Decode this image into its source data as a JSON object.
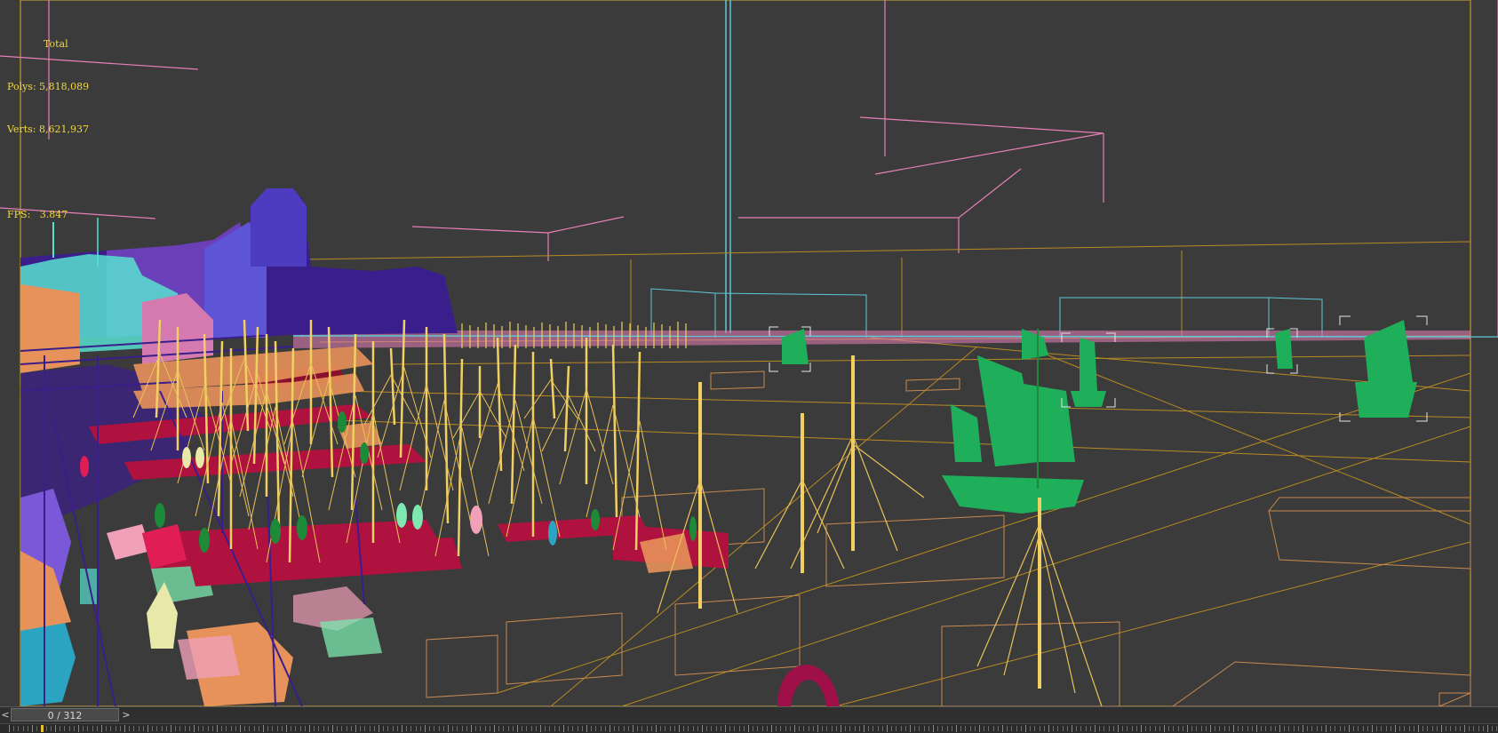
{
  "stats": {
    "title": "Total",
    "polys_label": "Polys:",
    "polys_value": "5,818,089",
    "verts_label": "Verts:",
    "verts_value": "8,621,937",
    "fps_label": "FPS:",
    "fps_value": "3.847"
  },
  "timeline": {
    "frame_display": "0 / 312",
    "prev_glyph": "<",
    "next_glyph": ">",
    "current_frame": 0,
    "total_frames": 312
  },
  "colors": {
    "viewport_bg": "#3b3b3b",
    "frame_border": "#d4a92c",
    "wire_yellow": "#e9c25a",
    "mast_yellow": "#f0cf63",
    "wire_orange": "#c98a4e",
    "wire_pink": "#e77fb8",
    "wire_cyan": "#5ec8d8",
    "ship_green": "#1fae5a",
    "pier_red": "#b0123f",
    "building_indigo": "#3a1e8c",
    "building_blue": "#5e54d6",
    "building_cyan": "#58e0d0",
    "crowd_orange": "#e7925a",
    "figure_green": "#1c8a38",
    "stats_text": "#f0d848"
  }
}
